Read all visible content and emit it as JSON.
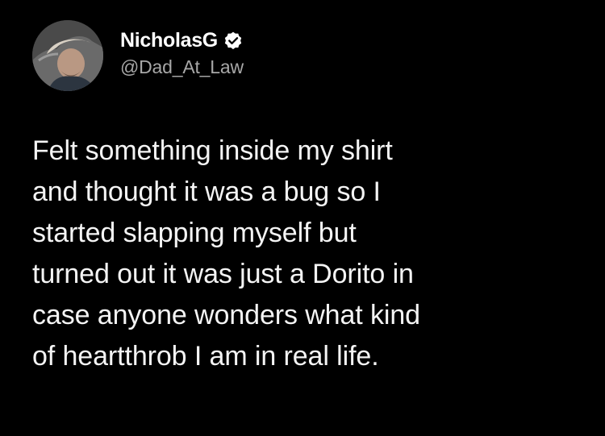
{
  "tweet": {
    "display_name": "NicholasG",
    "handle": "@Dad_At_Law",
    "verified_icon": "verified-badge-icon",
    "text_lines": [
      "Felt something inside my shirt",
      "and thought it was a bug so I",
      "started slapping myself but",
      "turned out it was just a Dorito in",
      "case anyone wonders what kind",
      "of heartthrob I am in real life."
    ]
  },
  "colors": {
    "background": "#000000",
    "name": "#ffffff",
    "handle": "#a7a7a7",
    "text": "#f4f4f4",
    "badge": "#ffffff"
  }
}
